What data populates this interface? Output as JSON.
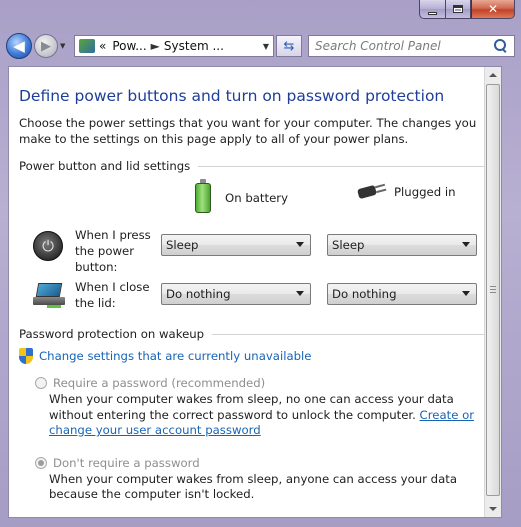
{
  "titlebar": {
    "close_glyph": "✕"
  },
  "address_bar": {
    "back_glyph": "◀",
    "forward_glyph": "▶",
    "crumb_prefix": "«",
    "crumbs": [
      "Pow...",
      "System ..."
    ],
    "crumb_separator": "►",
    "dropdown_glyph": "▼",
    "refresh_glyph": "⇆",
    "search_placeholder": "Search Control Panel"
  },
  "page": {
    "title": "Define power buttons and turn on password protection",
    "intro": "Choose the power settings that you want for your computer. The changes you make to the settings on this page apply to all of your power plans.",
    "power_section": {
      "heading": "Power button and lid settings",
      "columns": {
        "on_battery": "On battery",
        "plugged_in": "Plugged in"
      },
      "rows": [
        {
          "label": "When I press the power button:",
          "on_battery": "Sleep",
          "plugged_in": "Sleep",
          "icon": "power-button-icon"
        },
        {
          "label": "When I close the lid:",
          "on_battery": "Do nothing",
          "plugged_in": "Do nothing",
          "icon": "laptop-lid-icon"
        }
      ]
    },
    "password_section": {
      "heading": "Password protection on wakeup",
      "change_settings_link": "Change settings that are currently unavailable",
      "require": {
        "label": "Require a password (recommended)",
        "checked": false,
        "desc_text": "When your computer wakes from sleep, no one can access your data without entering the correct password to unlock the computer. ",
        "desc_link": "Create or change your user account password"
      },
      "no_require": {
        "label": "Don't require a password",
        "checked": true,
        "desc_text": "When your computer wakes from sleep, anyone can access your data because the computer isn't locked."
      }
    }
  },
  "colors": {
    "title": "#1e3e99",
    "link": "#1764b6",
    "frame": "#a9a0c7"
  }
}
